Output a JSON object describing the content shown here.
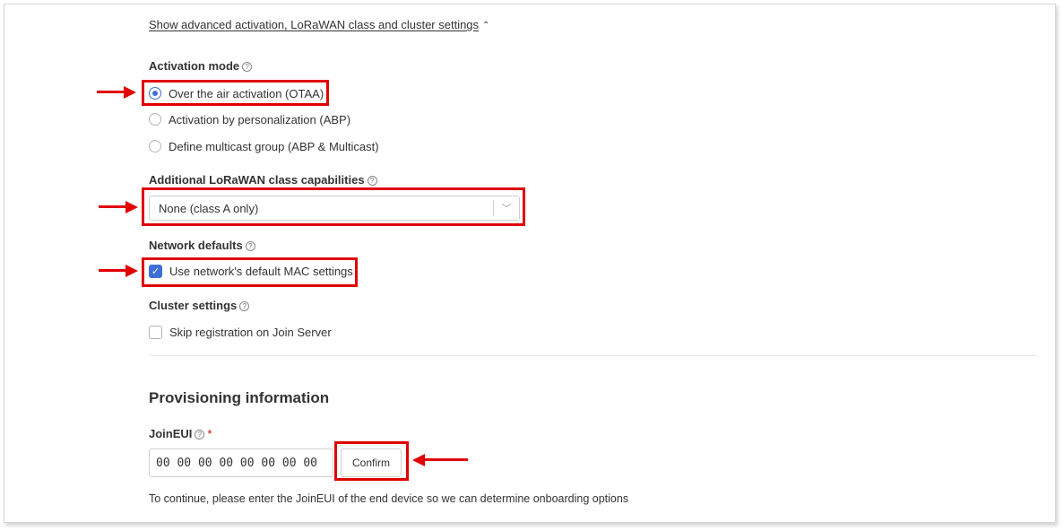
{
  "advanced_toggle": {
    "label": "Show advanced activation, LoRaWAN class and cluster settings",
    "chevron": "⌃"
  },
  "activation_mode": {
    "label": "Activation mode",
    "options": [
      {
        "label": "Over the air activation (OTAA)",
        "selected": true
      },
      {
        "label": "Activation by personalization (ABP)",
        "selected": false
      },
      {
        "label": "Define multicast group (ABP & Multicast)",
        "selected": false
      }
    ]
  },
  "class_capabilities": {
    "label": "Additional LoRaWAN class capabilities",
    "value": "None (class A only)"
  },
  "network_defaults": {
    "label": "Network defaults",
    "checkbox_label": "Use network's default MAC settings",
    "checked": true
  },
  "cluster_settings": {
    "label": "Cluster settings",
    "checkbox_label": "Skip registration on Join Server",
    "checked": false
  },
  "provisioning": {
    "heading": "Provisioning information",
    "joineui_label": "JoinEUI",
    "required_mark": "*",
    "joineui_value": "00 00 00 00 00 00 00 00",
    "confirm_label": "Confirm",
    "hint": "To continue, please enter the JoinEUI of the end device so we can determine onboarding options"
  },
  "icons": {
    "help": "?",
    "check": "✓",
    "caret": "﹀"
  },
  "colors": {
    "annotation": "#e00000",
    "accent": "#3d6fd8"
  }
}
